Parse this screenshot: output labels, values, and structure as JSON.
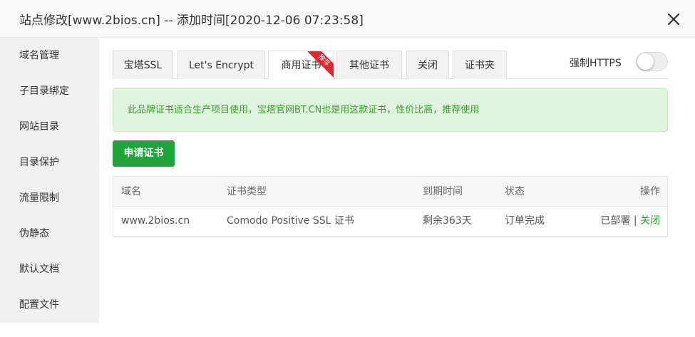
{
  "window": {
    "title": "站点修改[www.2bios.cn] -- 添加时间[2020-12-06 07:23:58]"
  },
  "sidebar": {
    "items": [
      {
        "label": "域名管理"
      },
      {
        "label": "子目录绑定"
      },
      {
        "label": "网站目录"
      },
      {
        "label": "目录保护"
      },
      {
        "label": "流量限制"
      },
      {
        "label": "伪静态"
      },
      {
        "label": "默认文档"
      },
      {
        "label": "配置文件"
      }
    ]
  },
  "tabs": {
    "items": [
      {
        "label": "宝塔SSL"
      },
      {
        "label": "Let's Encrypt"
      },
      {
        "label": "商用证书",
        "active": true,
        "badge": "推荐"
      },
      {
        "label": "其他证书"
      },
      {
        "label": "关闭"
      },
      {
        "label": "证书夹"
      }
    ]
  },
  "force_https": {
    "label": "强制HTTPS",
    "enabled": false
  },
  "notice": {
    "text": "此品牌证书适合生产项目使用，宝塔官网BT.CN也是用这款证书，性价比高，推荐使用"
  },
  "apply_button": {
    "label": "申请证书"
  },
  "table": {
    "headers": {
      "domain": "域名",
      "cert_type": "证书类型",
      "expiry": "到期时间",
      "status": "状态",
      "actions": "操作"
    },
    "rows": [
      {
        "domain": "www.2bios.cn",
        "cert_type": "Comodo Positive SSL 证书",
        "expiry": "剩余363天",
        "status": "订单完成",
        "deployed": "已部署",
        "separator": "|",
        "close": "关闭"
      }
    ]
  },
  "colors": {
    "accent_green": "#20a53a",
    "notice_bg": "#dff4dc",
    "badge_red": "#e0262e",
    "sidebar_bg": "#f0f0f0"
  },
  "icons": {
    "close": "close-icon"
  }
}
